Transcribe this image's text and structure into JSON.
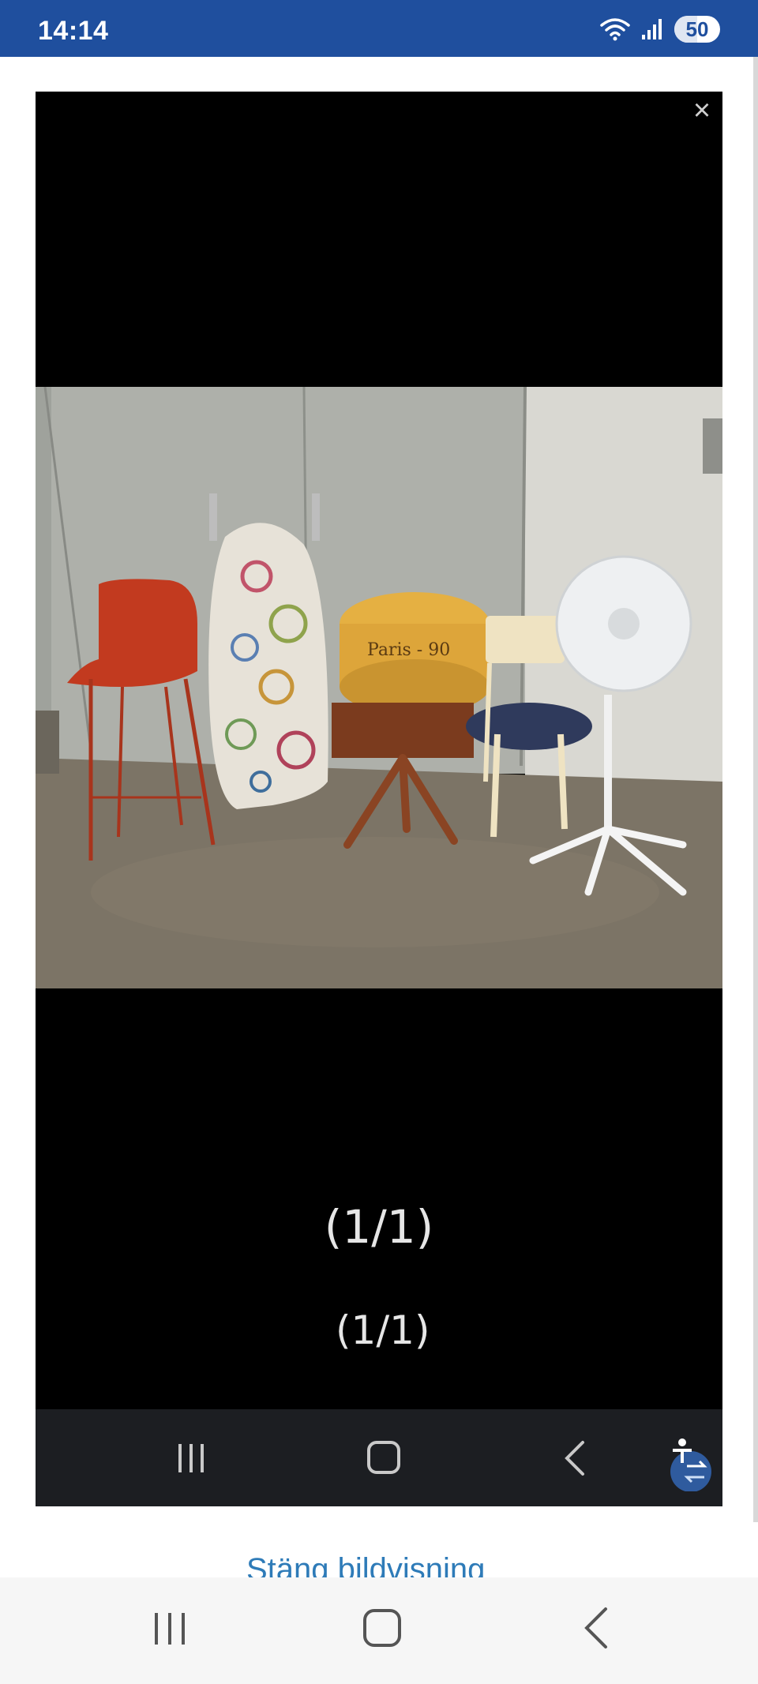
{
  "status_bar": {
    "time": "14:14",
    "battery": "50",
    "battery_level": 0.5,
    "icons": [
      "wifi-icon",
      "signal-icon",
      "battery-icon"
    ]
  },
  "viewer": {
    "close_label": "×",
    "photo_description_icon": "photo-image",
    "counter_primary": "(1/1)",
    "counter_secondary": "(1/1)"
  },
  "page": {
    "close_link": "Stäng bildvisning"
  },
  "navigation": {
    "icons": [
      "recents-icon",
      "home-icon",
      "back-icon",
      "accessibility-icon"
    ]
  },
  "colors": {
    "status_bar": "#1f4f9e",
    "link": "#2e7bb8",
    "viewer_bg": "#000000"
  }
}
